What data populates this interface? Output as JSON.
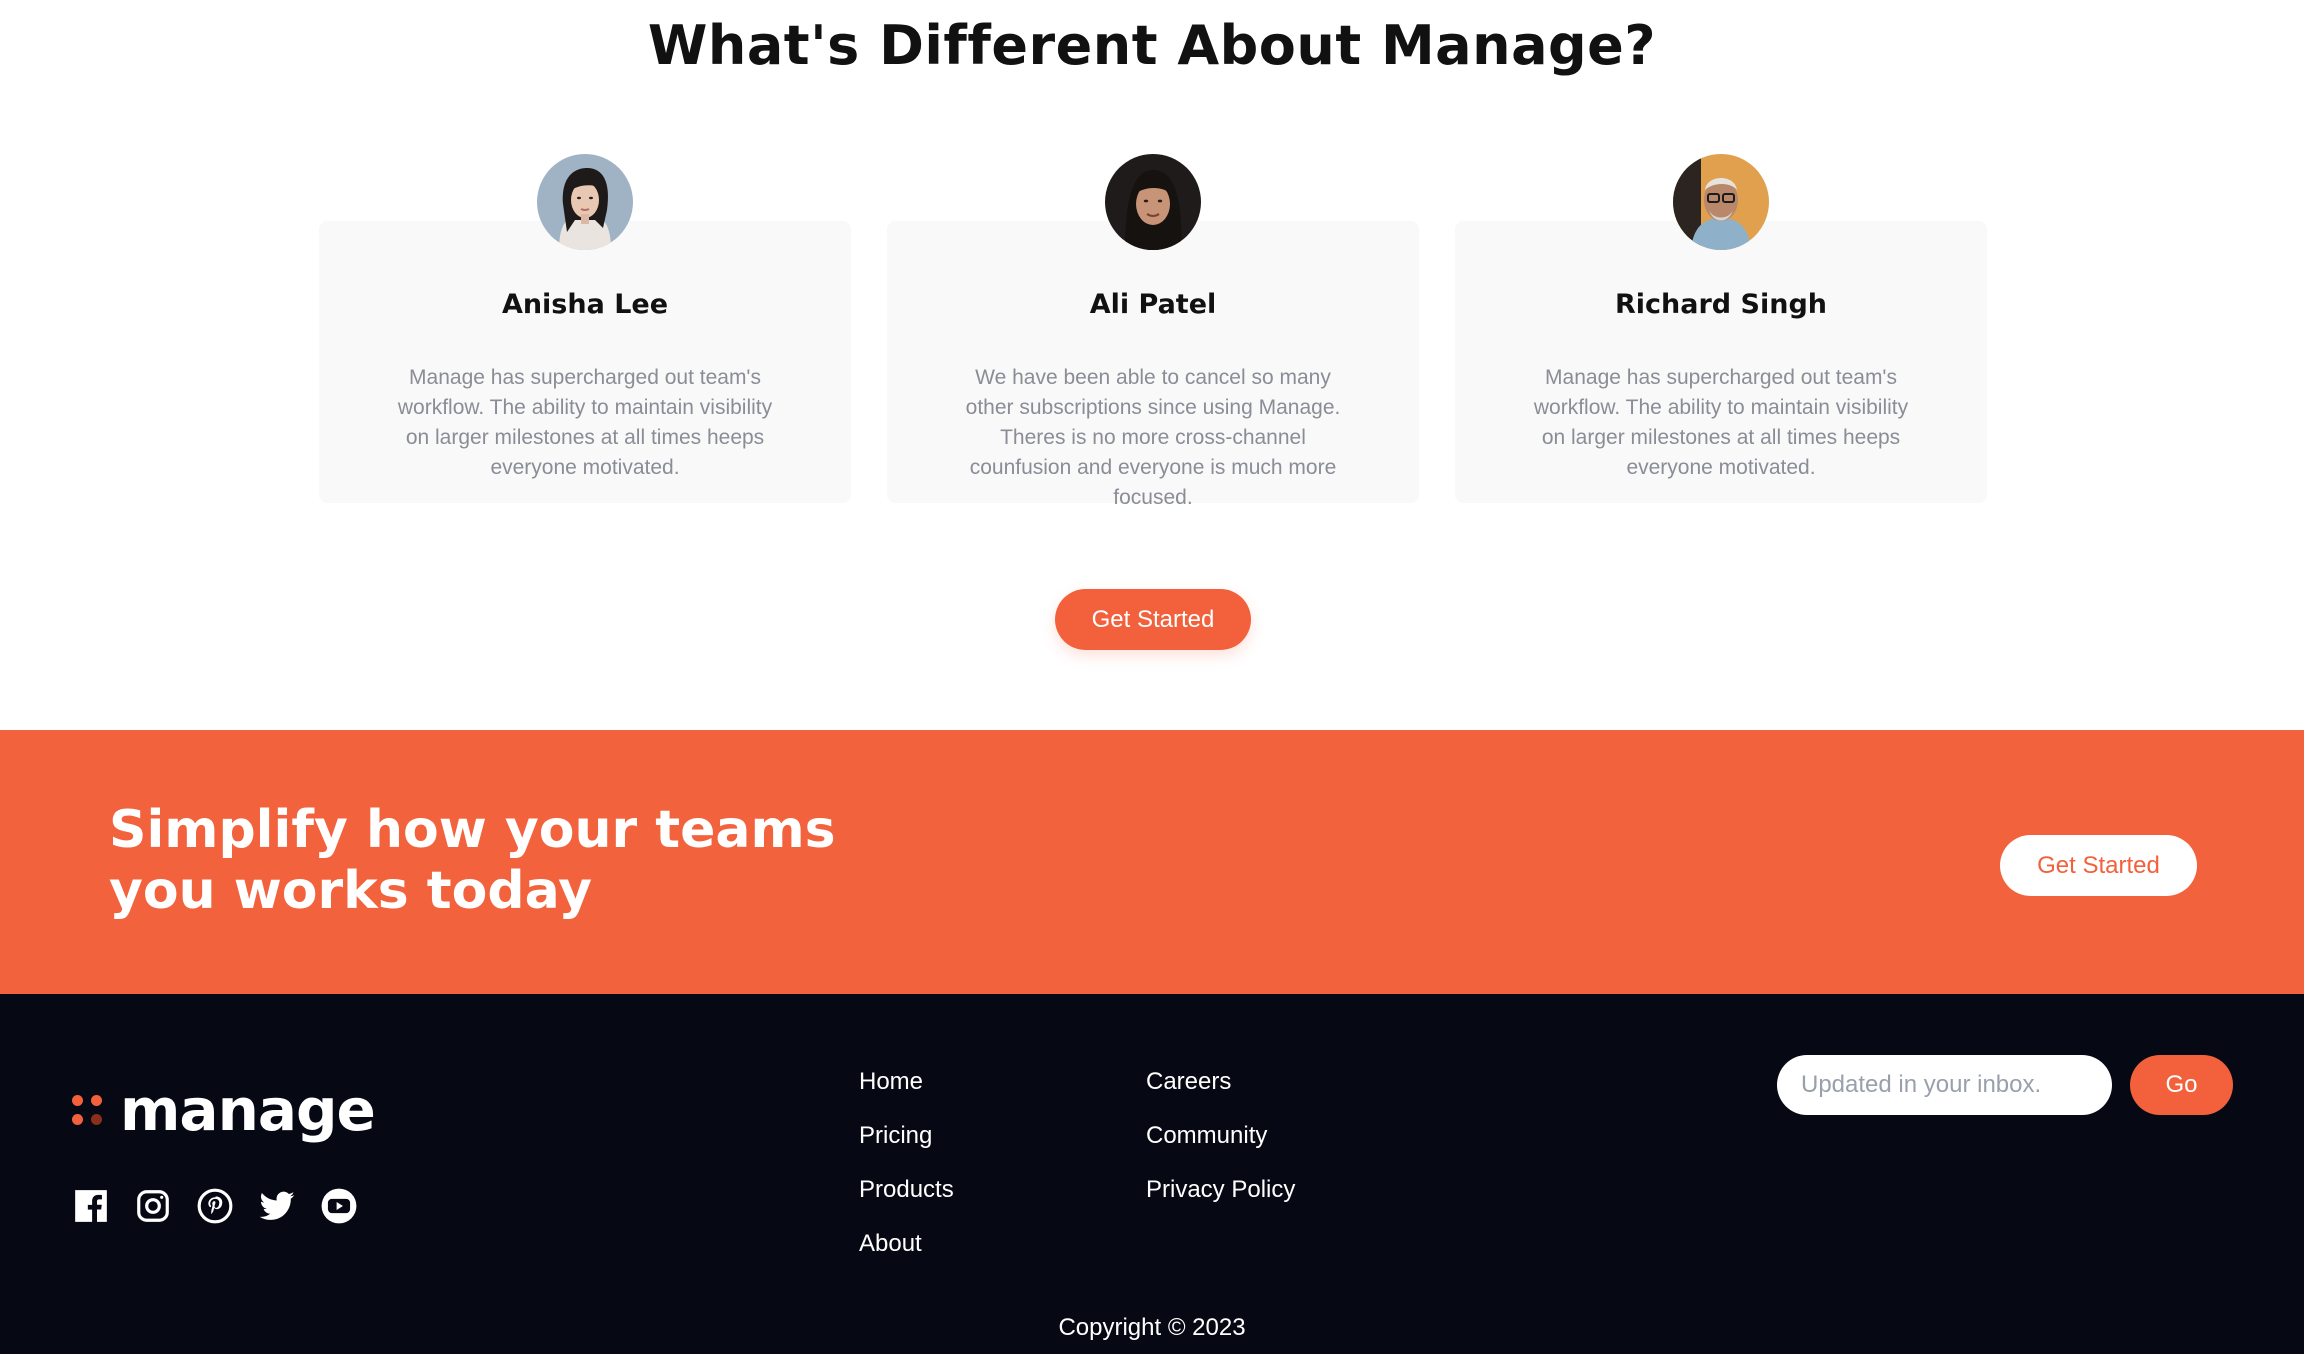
{
  "section": {
    "title": "What's Different About Manage?"
  },
  "testimonials": [
    {
      "name": "Anisha Lee",
      "quote": "Manage has supercharged out team's workflow. The ability to maintain visibility on larger milestones at all times heeps everyone motivated."
    },
    {
      "name": "Ali Patel",
      "quote": "We have been able to cancel so many other subscriptions since using Manage. Theres is no more cross-channel counfusion and everyone is much more focused."
    },
    {
      "name": "Richard Singh",
      "quote": "Manage has supercharged out team's workflow. The ability to maintain visibility on larger milestones at all times heeps everyone motivated."
    }
  ],
  "primary_cta": {
    "label": "Get Started"
  },
  "cta_band": {
    "heading": "Simplify how your teams you works today",
    "button_label": "Get Started"
  },
  "footer": {
    "logo_text": "manage",
    "socials": [
      "facebook-icon",
      "instagram-icon",
      "pinterest-icon",
      "twitter-icon",
      "youtube-icon"
    ],
    "nav_col_1": [
      "Home",
      "Pricing",
      "Products",
      "About"
    ],
    "nav_col_2": [
      "Careers",
      "Community",
      "Privacy Policy"
    ],
    "newsletter": {
      "placeholder": "Updated in your inbox.",
      "button_label": "Go"
    },
    "copyright": "Copyright © 2023"
  },
  "colors": {
    "accent": "#f2613c",
    "footer_bg": "#060914",
    "card_bg": "#f9f9f9",
    "muted_text": "#8a8d96"
  }
}
